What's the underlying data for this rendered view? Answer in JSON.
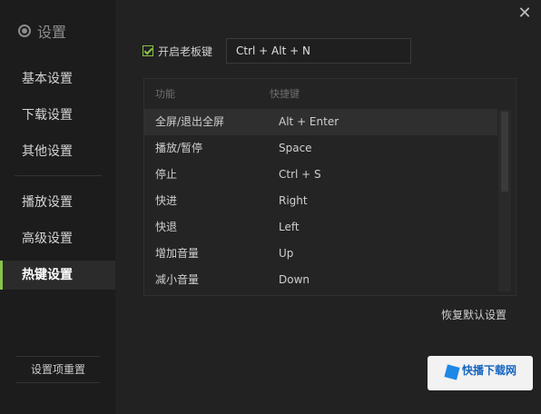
{
  "window": {
    "close_glyph": "✕"
  },
  "sidebar": {
    "title": "设置",
    "items": [
      {
        "label": "基本设置",
        "active": false
      },
      {
        "label": "下载设置",
        "active": false
      },
      {
        "label": "其他设置",
        "active": false
      },
      {
        "label": "播放设置",
        "active": false
      },
      {
        "label": "高级设置",
        "active": false
      },
      {
        "label": "热键设置",
        "active": true
      }
    ],
    "footer_button": "设置项重置"
  },
  "boss_key": {
    "checkbox_label": "开启老板键",
    "checked": true,
    "hotkey_value": "Ctrl + Alt + N"
  },
  "hotkey_table": {
    "headers": {
      "function": "功能",
      "key": "快捷键"
    },
    "rows": [
      {
        "function": "全屏/退出全屏",
        "key": "Alt + Enter",
        "selected": true
      },
      {
        "function": "播放/暂停",
        "key": "Space",
        "selected": false
      },
      {
        "function": "停止",
        "key": "Ctrl + S",
        "selected": false
      },
      {
        "function": "快进",
        "key": "Right",
        "selected": false
      },
      {
        "function": "快退",
        "key": "Left",
        "selected": false
      },
      {
        "function": "增加音量",
        "key": "Up",
        "selected": false
      },
      {
        "function": "减小音量",
        "key": "Down",
        "selected": false
      }
    ]
  },
  "restore_defaults": "恢复默认设置",
  "watermark": {
    "text": "快播下载网"
  },
  "colors": {
    "accent": "#8bc34a",
    "background": "#222222",
    "sidebar": "#1c1c1c"
  }
}
